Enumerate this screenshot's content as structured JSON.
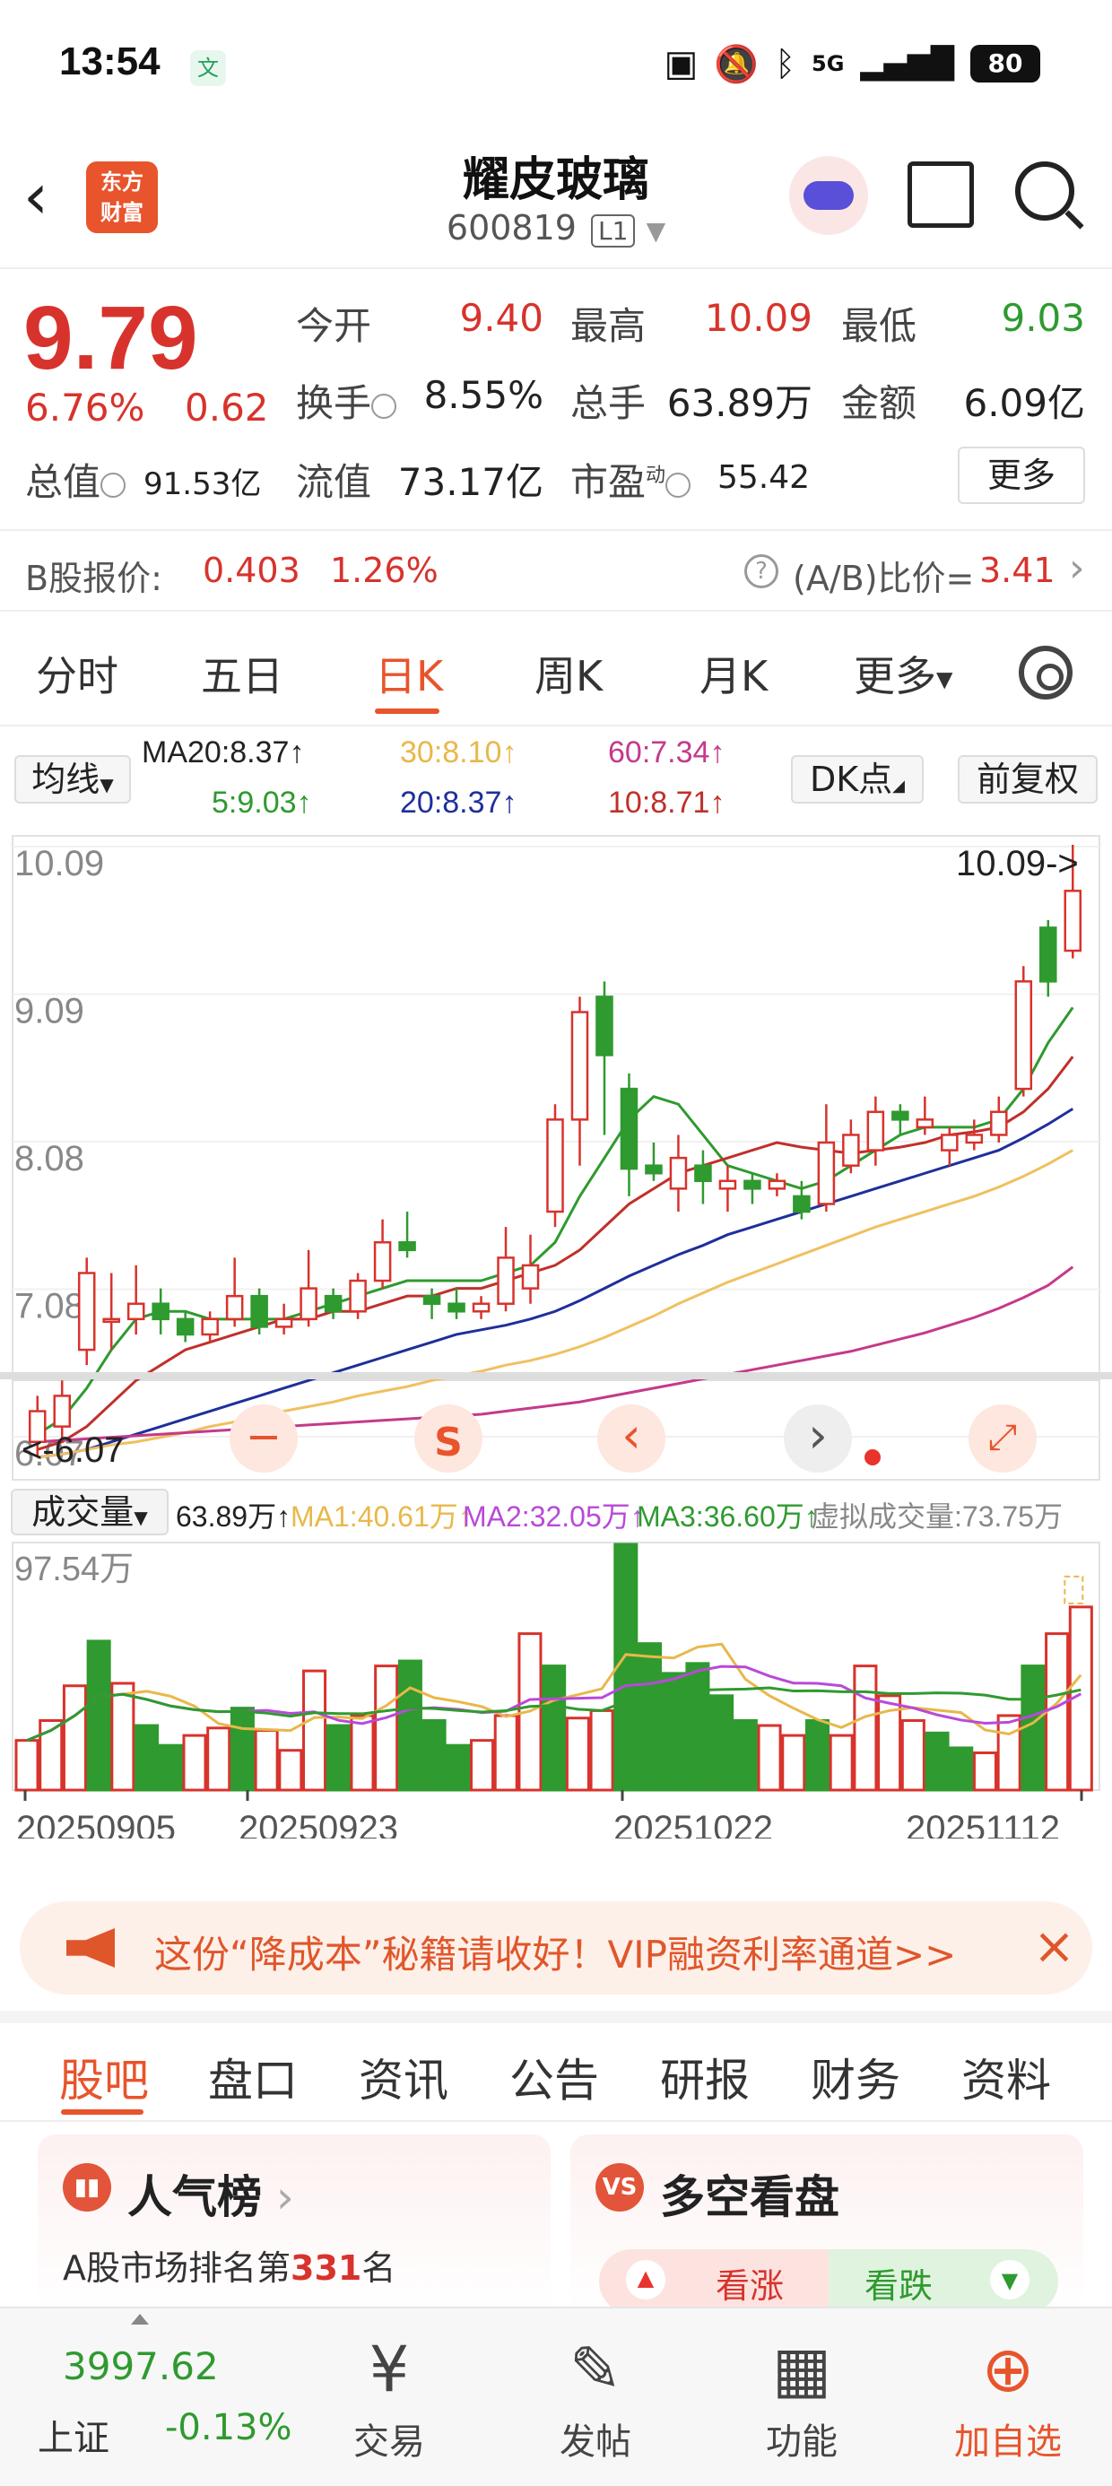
{
  "status_bar": {
    "time": "13:54",
    "app_icon_glyph": "文",
    "icons": [
      "nfc-icon",
      "mute-icon",
      "bluetooth-icon",
      "5g-signal-icon"
    ],
    "signal_label": "5G",
    "battery": "80"
  },
  "header": {
    "logo_line1": "东方",
    "logo_line2": "财富",
    "stock_name": "耀皮玻璃",
    "stock_code": "600819",
    "level_badge": "L1"
  },
  "quote": {
    "price": "9.79",
    "change_pct": "6.76%",
    "change_abs": "0.62",
    "open_label": "今开",
    "open": "9.40",
    "high_label": "最高",
    "high": "10.09",
    "low_label": "最低",
    "low": "9.03",
    "turnover_label": "换手",
    "turnover": "8.55%",
    "volume_label": "总手",
    "volume": "63.89万",
    "amount_label": "金额",
    "amount": "6.09亿",
    "market_cap_label": "总值",
    "market_cap": "91.53亿",
    "float_cap_label": "流值",
    "float_cap": "73.17亿",
    "pe_label": "市盈",
    "pe_sup": "动",
    "pe": "55.42",
    "more_label": "更多",
    "b_share_label": "B股报价:",
    "b_share_price": "0.403",
    "b_share_pct": "1.26%",
    "ab_ratio_label": "(A/B)比价=",
    "ab_ratio": "3.41"
  },
  "kline_tabs": {
    "items": [
      "分时",
      "五日",
      "日K",
      "周K",
      "月K",
      "更多"
    ],
    "active": "日K"
  },
  "ma_legend": {
    "select_label": "均线",
    "ma20_label": "MA20:8.37↑",
    "ma30": "30:8.10↑",
    "ma60": "60:7.34↑",
    "ma5": "5:9.03↑",
    "ma20": "20:8.37↑",
    "ma10": "10:8.71↑",
    "dk_label": "DK点",
    "adjust_label": "前复权"
  },
  "colors": {
    "up": "#d7332c",
    "down": "#2f9a2f",
    "ma5": "#2f9a2f",
    "ma10": "#c0302a",
    "ma20": "#1f2f9a",
    "ma30": "#f0c060",
    "ma60": "#c43a8a",
    "accent": "#e8542c"
  },
  "chart_data": [
    {
      "type": "candlestick",
      "y_axis_labels": [
        "10.09",
        "9.09",
        "8.08",
        "7.08",
        "6.07"
      ],
      "ylim": [
        6.07,
        10.09
      ],
      "max_annotation": "10.09->",
      "min_annotation": "<-6.07",
      "x_labels": [
        "20250905",
        "20250923",
        "20251022",
        "20251112"
      ],
      "candles": [
        {
          "o": 6.2,
          "c": 6.4,
          "h": 6.5,
          "l": 6.1,
          "up": true
        },
        {
          "o": 6.3,
          "c": 6.5,
          "h": 6.6,
          "l": 6.2,
          "up": true
        },
        {
          "o": 6.8,
          "c": 7.3,
          "h": 7.4,
          "l": 6.7,
          "up": true
        },
        {
          "o": 7.0,
          "c": 7.0,
          "h": 7.3,
          "l": 6.8,
          "up": true
        },
        {
          "o": 7.0,
          "c": 7.1,
          "h": 7.35,
          "l": 6.9,
          "up": true
        },
        {
          "o": 7.1,
          "c": 7.0,
          "h": 7.2,
          "l": 6.9,
          "up": false
        },
        {
          "o": 7.0,
          "c": 6.9,
          "h": 7.05,
          "l": 6.85,
          "up": false
        },
        {
          "o": 6.9,
          "c": 7.0,
          "h": 7.05,
          "l": 6.85,
          "up": true
        },
        {
          "o": 7.0,
          "c": 7.15,
          "h": 7.4,
          "l": 6.95,
          "up": true
        },
        {
          "o": 7.15,
          "c": 6.95,
          "h": 7.2,
          "l": 6.9,
          "up": false
        },
        {
          "o": 6.95,
          "c": 7.0,
          "h": 7.1,
          "l": 6.9,
          "up": true
        },
        {
          "o": 7.0,
          "c": 7.2,
          "h": 7.45,
          "l": 6.95,
          "up": true
        },
        {
          "o": 7.15,
          "c": 7.05,
          "h": 7.2,
          "l": 7.0,
          "up": false
        },
        {
          "o": 7.05,
          "c": 7.25,
          "h": 7.3,
          "l": 7.0,
          "up": true
        },
        {
          "o": 7.25,
          "c": 7.5,
          "h": 7.65,
          "l": 7.2,
          "up": true
        },
        {
          "o": 7.5,
          "c": 7.45,
          "h": 7.7,
          "l": 7.4,
          "up": false
        },
        {
          "o": 7.15,
          "c": 7.1,
          "h": 7.2,
          "l": 7.0,
          "up": false
        },
        {
          "o": 7.1,
          "c": 7.05,
          "h": 7.2,
          "l": 7.0,
          "up": false
        },
        {
          "o": 7.05,
          "c": 7.1,
          "h": 7.15,
          "l": 7.0,
          "up": true
        },
        {
          "o": 7.1,
          "c": 7.4,
          "h": 7.6,
          "l": 7.05,
          "up": true
        },
        {
          "o": 7.2,
          "c": 7.35,
          "h": 7.55,
          "l": 7.1,
          "up": true
        },
        {
          "o": 7.7,
          "c": 8.3,
          "h": 8.4,
          "l": 7.6,
          "up": true
        },
        {
          "o": 8.3,
          "c": 9.0,
          "h": 9.1,
          "l": 8.0,
          "up": true
        },
        {
          "o": 9.1,
          "c": 8.72,
          "h": 9.2,
          "l": 8.2,
          "up": false
        },
        {
          "o": 8.5,
          "c": 7.98,
          "h": 8.6,
          "l": 7.8,
          "up": false
        },
        {
          "o": 8.0,
          "c": 7.95,
          "h": 8.15,
          "l": 7.9,
          "up": false
        },
        {
          "o": 7.85,
          "c": 8.05,
          "h": 8.2,
          "l": 7.7,
          "up": true
        },
        {
          "o": 8.0,
          "c": 7.9,
          "h": 8.1,
          "l": 7.75,
          "up": false
        },
        {
          "o": 7.85,
          "c": 7.9,
          "h": 8.0,
          "l": 7.7,
          "up": true
        },
        {
          "o": 7.9,
          "c": 7.85,
          "h": 7.95,
          "l": 7.75,
          "up": false
        },
        {
          "o": 7.85,
          "c": 7.9,
          "h": 7.95,
          "l": 7.8,
          "up": true
        },
        {
          "o": 7.8,
          "c": 7.7,
          "h": 7.9,
          "l": 7.65,
          "up": false
        },
        {
          "o": 7.75,
          "c": 8.15,
          "h": 8.4,
          "l": 7.7,
          "up": true
        },
        {
          "o": 8.0,
          "c": 8.2,
          "h": 8.3,
          "l": 7.95,
          "up": true
        },
        {
          "o": 8.1,
          "c": 8.35,
          "h": 8.45,
          "l": 8.0,
          "up": true
        },
        {
          "o": 8.35,
          "c": 8.3,
          "h": 8.4,
          "l": 8.2,
          "up": false
        },
        {
          "o": 8.25,
          "c": 8.3,
          "h": 8.45,
          "l": 8.2,
          "up": true
        },
        {
          "o": 8.1,
          "c": 8.2,
          "h": 8.25,
          "l": 8.0,
          "up": true
        },
        {
          "o": 8.15,
          "c": 8.2,
          "h": 8.3,
          "l": 8.1,
          "up": true
        },
        {
          "o": 8.2,
          "c": 8.35,
          "h": 8.45,
          "l": 8.15,
          "up": true
        },
        {
          "o": 8.5,
          "c": 9.2,
          "h": 9.3,
          "l": 8.45,
          "up": true
        },
        {
          "o": 9.55,
          "c": 9.2,
          "h": 9.6,
          "l": 9.1,
          "up": false
        },
        {
          "o": 9.4,
          "c": 9.79,
          "h": 10.09,
          "l": 9.35,
          "up": true
        }
      ],
      "ma_series": [
        {
          "name": "5",
          "color_key": "ma5",
          "values": [
            6.25,
            6.35,
            6.55,
            6.8,
            7.0,
            7.05,
            7.05,
            7.0,
            7.0,
            7.0,
            7.0,
            7.05,
            7.1,
            7.15,
            7.2,
            7.25,
            7.25,
            7.25,
            7.25,
            7.3,
            7.35,
            7.5,
            7.8,
            8.05,
            8.3,
            8.45,
            8.4,
            8.2,
            8.0,
            7.95,
            7.9,
            7.85,
            7.9,
            8.0,
            8.1,
            8.2,
            8.25,
            8.25,
            8.25,
            8.3,
            8.5,
            8.8,
            9.03
          ]
        },
        {
          "name": "10",
          "color_key": "ma10",
          "values": [
            6.15,
            6.2,
            6.3,
            6.45,
            6.6,
            6.7,
            6.8,
            6.85,
            6.9,
            6.95,
            7.0,
            7.0,
            7.05,
            7.05,
            7.1,
            7.15,
            7.15,
            7.2,
            7.2,
            7.25,
            7.3,
            7.35,
            7.45,
            7.6,
            7.75,
            7.85,
            7.95,
            8.0,
            8.05,
            8.1,
            8.15,
            8.12,
            8.1,
            8.08,
            8.1,
            8.12,
            8.15,
            8.2,
            8.22,
            8.25,
            8.35,
            8.5,
            8.71
          ]
        },
        {
          "name": "20",
          "color_key": "ma20",
          "values": [
            6.1,
            6.12,
            6.15,
            6.2,
            6.25,
            6.3,
            6.35,
            6.4,
            6.45,
            6.5,
            6.55,
            6.6,
            6.65,
            6.7,
            6.75,
            6.8,
            6.85,
            6.9,
            6.93,
            6.96,
            7.0,
            7.05,
            7.12,
            7.2,
            7.28,
            7.35,
            7.42,
            7.48,
            7.55,
            7.6,
            7.65,
            7.7,
            7.75,
            7.8,
            7.85,
            7.9,
            7.95,
            8.0,
            8.05,
            8.1,
            8.18,
            8.27,
            8.37
          ]
        },
        {
          "name": "30",
          "color_key": "ma30",
          "values": [
            6.1,
            6.12,
            6.15,
            6.18,
            6.2,
            6.23,
            6.26,
            6.3,
            6.33,
            6.36,
            6.4,
            6.43,
            6.46,
            6.5,
            6.53,
            6.56,
            6.6,
            6.63,
            6.66,
            6.7,
            6.73,
            6.77,
            6.82,
            6.88,
            6.95,
            7.02,
            7.1,
            7.17,
            7.24,
            7.3,
            7.36,
            7.42,
            7.48,
            7.54,
            7.6,
            7.65,
            7.7,
            7.75,
            7.8,
            7.86,
            7.93,
            8.01,
            8.1
          ]
        },
        {
          "name": "60",
          "color_key": "ma60",
          "values": [
            6.2,
            6.21,
            6.22,
            6.23,
            6.24,
            6.25,
            6.26,
            6.27,
            6.28,
            6.29,
            6.3,
            6.31,
            6.32,
            6.33,
            6.34,
            6.35,
            6.36,
            6.37,
            6.38,
            6.4,
            6.42,
            6.44,
            6.46,
            6.49,
            6.52,
            6.55,
            6.58,
            6.61,
            6.64,
            6.67,
            6.7,
            6.73,
            6.76,
            6.79,
            6.83,
            6.87,
            6.91,
            6.96,
            7.01,
            7.07,
            7.14,
            7.22,
            7.34
          ]
        }
      ]
    },
    {
      "type": "bar",
      "title": "成交量",
      "legend": {
        "select_label": "成交量",
        "vol": "63.89万↑",
        "ma1": "MA1:40.61万↑",
        "ma2": "MA2:32.05万↑",
        "ma3": "MA3:36.60万↑",
        "virtual": "虚拟成交量:73.75万"
      },
      "y_max_label": "97.54万",
      "ylim": [
        0,
        97.54
      ],
      "values": [
        20,
        28,
        42,
        60,
        43,
        26,
        18,
        22,
        25,
        33,
        24,
        16,
        48,
        26,
        30,
        50,
        52,
        28,
        18,
        20,
        30,
        63,
        50,
        29,
        32,
        99,
        59,
        47,
        51,
        38,
        28,
        26,
        22,
        28,
        22,
        50,
        38,
        28,
        23,
        17,
        15,
        30,
        50,
        63,
        73.75
      ],
      "up": [
        true,
        true,
        true,
        false,
        true,
        false,
        false,
        true,
        true,
        false,
        true,
        true,
        true,
        false,
        true,
        true,
        false,
        false,
        false,
        true,
        true,
        true,
        false,
        true,
        true,
        false,
        false,
        false,
        false,
        false,
        false,
        true,
        true,
        false,
        true,
        true,
        true,
        true,
        false,
        false,
        true,
        true,
        false,
        true,
        true
      ]
    }
  ],
  "chart_toolbar": {
    "minus_glyph": "−",
    "s_glyph": "S",
    "prev_glyph": "‹",
    "next_glyph": "›",
    "expand_glyph": "⤢"
  },
  "banner": {
    "text": "这份“降成本”秘籍请收好！VIP融资利率通道>>",
    "close_glyph": "×"
  },
  "sub_tabs": {
    "items": [
      "股吧",
      "盘口",
      "资讯",
      "公告",
      "研报",
      "财务",
      "资料"
    ],
    "active": "股吧"
  },
  "cards": {
    "popularity_title": "人气榜",
    "popularity_text_prefix": "A股市场排名第",
    "popularity_rank": "331",
    "popularity_text_suffix": "名",
    "sentiment_title": "多空看盘",
    "bull_label": "看涨",
    "bear_label": "看跌",
    "sentiment_badge": "VS"
  },
  "bottom_nav": {
    "index_value": "3997.62",
    "index_name": "上证",
    "index_change": "-0.13%",
    "trade": "交易",
    "post": "发帖",
    "features": "功能",
    "add_watch": "加自选"
  }
}
